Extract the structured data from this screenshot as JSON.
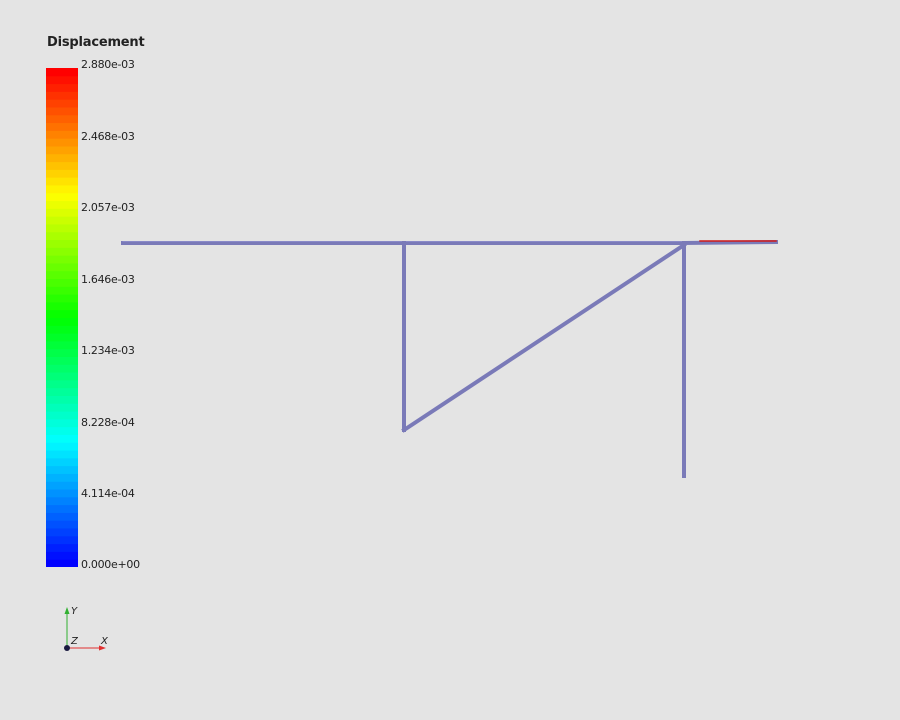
{
  "legend": {
    "title": "Displacement",
    "ticks": [
      "2.880e-03",
      "2.468e-03",
      "2.057e-03",
      "1.646e-03",
      "1.234e-03",
      "8.228e-04",
      "4.114e-04",
      "0.000e+00"
    ],
    "range": [
      0,
      0.00288
    ],
    "colormap": [
      "#0000ff",
      "#00ffff",
      "#00ff00",
      "#ffff00",
      "#ff0000"
    ]
  },
  "model": {
    "member_color": "#7a7ab8",
    "highlight_color": "#d01818"
  },
  "axes": {
    "x_label": "X",
    "y_label": "Y",
    "z_label": "Z",
    "x_color": "#e03030",
    "y_color": "#30b030",
    "z_color": "#1a1a40"
  }
}
